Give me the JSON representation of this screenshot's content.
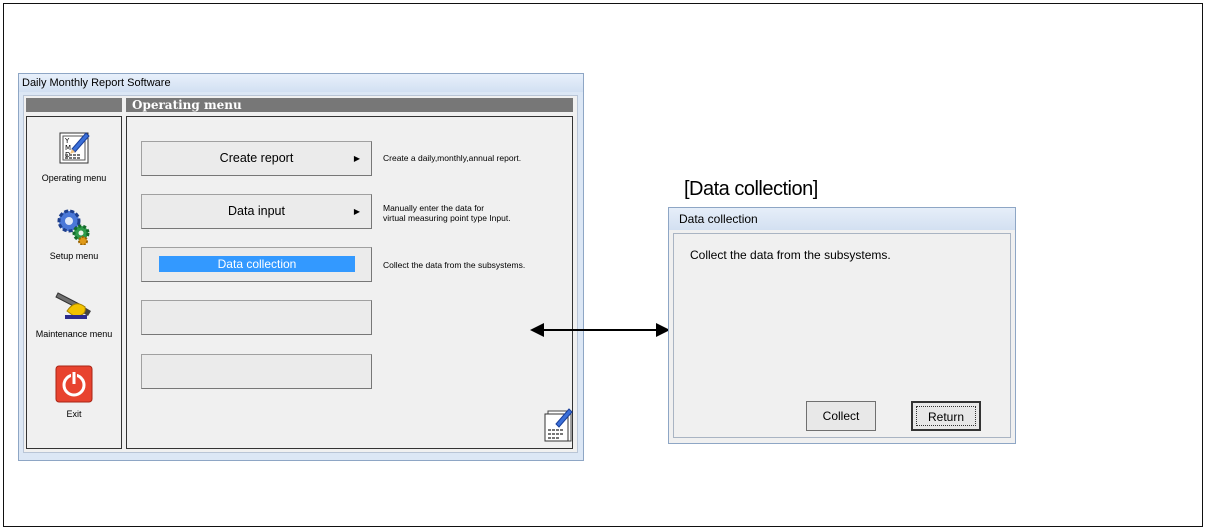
{
  "main_window": {
    "title": "Daily Monthly Report Software",
    "header": "Operating menu",
    "sidebar": [
      {
        "label": "Operating menu",
        "icon": "calendar-report-icon"
      },
      {
        "label": "Setup menu",
        "icon": "gears-icon"
      },
      {
        "label": "Maintenance menu",
        "icon": "tools-icon"
      },
      {
        "label": "Exit",
        "icon": "power-icon"
      }
    ],
    "menu": [
      {
        "label": "Create report",
        "arrow": "▶",
        "description": "Create a daily,monthly,annual report."
      },
      {
        "label": "Data input",
        "arrow": "▶",
        "description_line1": "Manually enter the data for",
        "description_line2": "virtual measuring point type Input."
      },
      {
        "label": "Data collection",
        "description": "Collect the data from the subsystems."
      }
    ]
  },
  "dialog": {
    "caption": "[Data collection]",
    "title": "Data collection",
    "message": "Collect the data from the subsystems.",
    "collect_label": "Collect",
    "return_label": "Return"
  },
  "colors": {
    "selected": "#3399ff",
    "header": "#777777",
    "exit": "#e8432f"
  }
}
